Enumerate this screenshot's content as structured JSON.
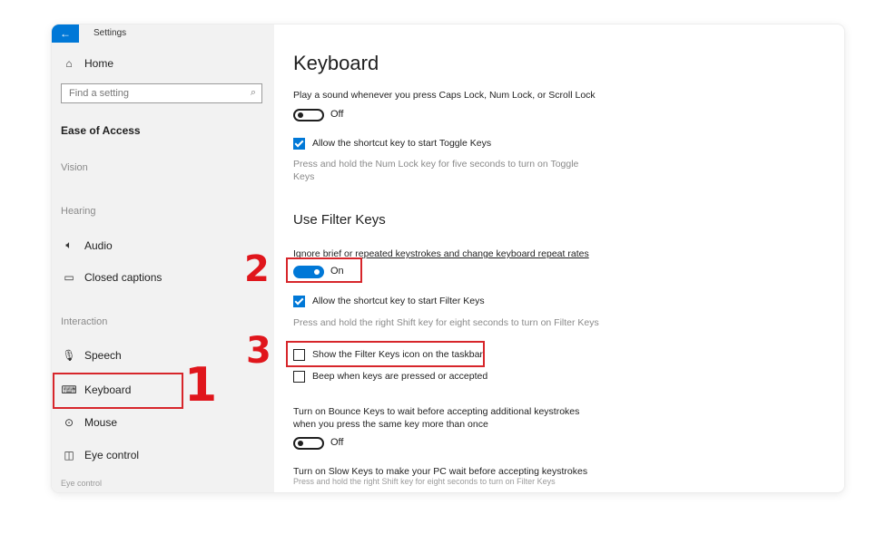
{
  "window": {
    "title": "Settings",
    "back_glyph": "←"
  },
  "sidebar": {
    "home": {
      "label": "Home",
      "icon": "home-icon"
    },
    "search": {
      "placeholder": "Find a setting",
      "icon": "search-icon"
    },
    "section": "Ease of Access",
    "groups": {
      "vision": "Vision",
      "hearing": "Hearing",
      "interaction": "Interaction"
    },
    "items": {
      "audio": {
        "label": "Audio",
        "icon": "speaker-icon"
      },
      "closed_captions": {
        "label": "Closed captions",
        "icon": "captions-icon"
      },
      "speech": {
        "label": "Speech",
        "icon": "microphone-icon"
      },
      "keyboard": {
        "label": "Keyboard",
        "icon": "keyboard-icon"
      },
      "mouse": {
        "label": "Mouse",
        "icon": "mouse-icon"
      },
      "eye_control": {
        "label": "Eye control",
        "icon": "eye-control-icon"
      }
    },
    "overlap_text": "Eye control"
  },
  "main": {
    "title": "Keyboard",
    "toggle_keys": {
      "sound_label": "Play a sound whenever you press Caps Lock, Num Lock, or Scroll Lock",
      "toggle_state": "Off",
      "shortcut_label": "Allow the shortcut key to start Toggle Keys",
      "shortcut_checked": true,
      "desc_line1": "Press and hold the Num Lock key for five seconds to turn on Toggle",
      "desc_line2": "Keys"
    },
    "filter_keys": {
      "heading": "Use Filter Keys",
      "description": "Ignore brief or repeated keystrokes and change keyboard repeat rates",
      "toggle_state": "On",
      "shortcut_label": "Allow the shortcut key to start Filter Keys",
      "shortcut_checked": true,
      "shortcut_desc": "Press and hold the right Shift key for eight seconds to turn on Filter Keys",
      "taskbar_icon_label": "Show the Filter Keys icon on the taskbar",
      "taskbar_icon_checked": false,
      "beep_label": "Beep when keys are pressed or accepted",
      "beep_checked": false
    },
    "bounce_keys": {
      "label_line1": "Turn on Bounce Keys to wait before accepting additional keystrokes",
      "label_line2": "when you press the same key more than once",
      "toggle_state": "Off"
    },
    "slow_keys": {
      "label": "Turn on Slow Keys to make your PC wait before accepting keystrokes",
      "overlap_text": "Press and hold the right Shift key for eight seconds to turn on Filter Keys"
    }
  },
  "annotations": {
    "step1": "1",
    "step2": "2",
    "step3": "3",
    "color": "#e0161c"
  },
  "colors": {
    "accent": "#0078d7",
    "sidebar_bg": "#f2f2f2",
    "highlight": "#d7262b"
  }
}
